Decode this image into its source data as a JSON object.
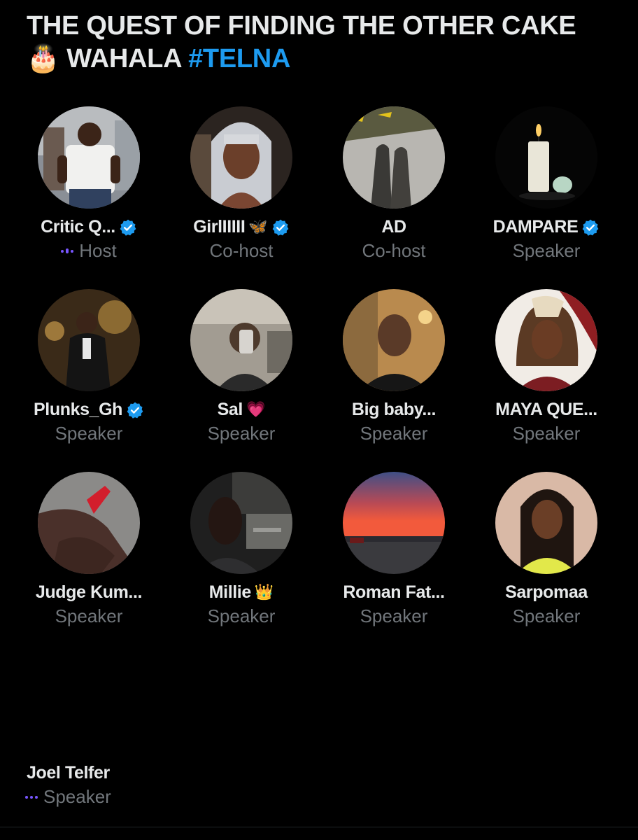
{
  "space": {
    "title_part1": "THE QUEST OF FINDING THE OTHER CAKE",
    "title_emoji": "🎂",
    "title_part2": "WAHALA",
    "hashtag": "#TELNA"
  },
  "participants": [
    {
      "name": "Critic Q...",
      "role": "Host",
      "verified": true
    },
    {
      "name": "GirlIIIII",
      "emoji": "🦋",
      "role": "Co-host",
      "verified": true
    },
    {
      "name": "AD",
      "role": "Co-host",
      "verified": false
    },
    {
      "name": "DAMPARE",
      "role": "Speaker",
      "verified": true
    },
    {
      "name": "Plunks_Gh",
      "role": "Speaker",
      "verified": true
    },
    {
      "name": "Sal",
      "emoji": "💗",
      "role": "Speaker",
      "verified": false
    },
    {
      "name": "Big baby...",
      "role": "Speaker",
      "verified": false
    },
    {
      "name": "MAYA QUE...",
      "role": "Speaker",
      "verified": false
    },
    {
      "name": "Judge Kum...",
      "role": "Speaker",
      "verified": false
    },
    {
      "name": "Millie",
      "emoji": "👑",
      "role": "Speaker",
      "verified": false
    },
    {
      "name": "Roman Fat...",
      "role": "Speaker",
      "verified": false
    },
    {
      "name": "Sarpomaa",
      "role": "Speaker",
      "verified": false
    },
    {
      "name": "Joel Telfer",
      "role": "Speaker",
      "verified": false
    }
  ],
  "colors": {
    "background": "#000000",
    "text_primary": "#e7e9ea",
    "text_secondary": "#71767b",
    "accent_blue": "#1d9bf0",
    "speaking_indicator": "#7856ff"
  }
}
